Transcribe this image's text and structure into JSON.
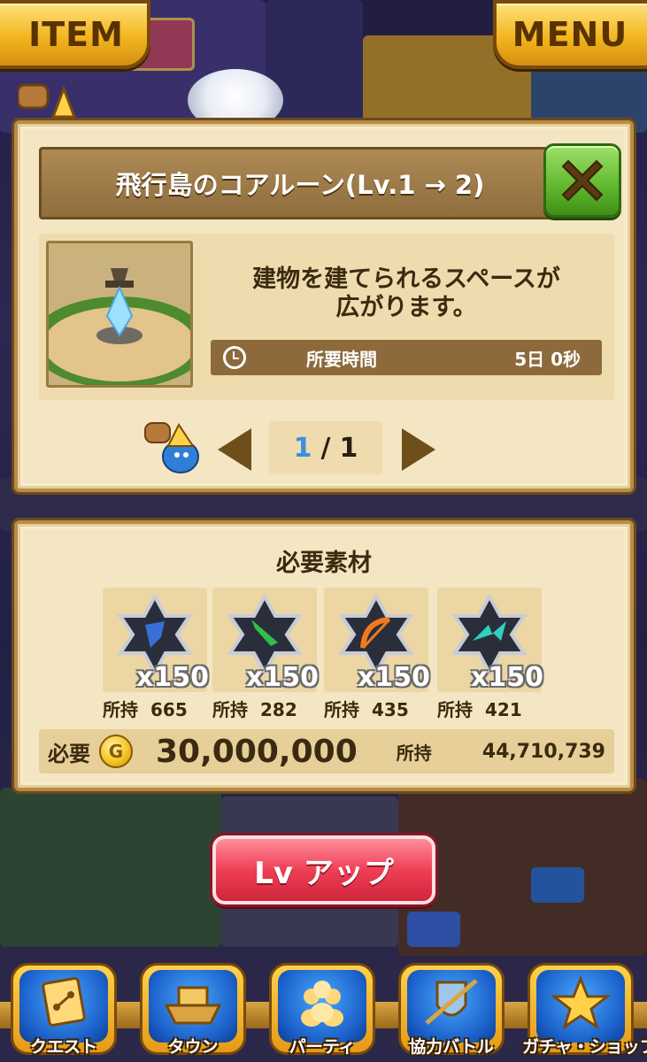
{
  "top_bar": {
    "item_label": "ITEM",
    "menu_label": "MENU"
  },
  "upgrade_panel": {
    "title": "飛行島のコアルーン(Lv.1 → 2)",
    "description_line1": "建物を建てられるスペースが",
    "description_line2": "広がります。",
    "time_label": "所要時間",
    "time_value": "5日 0秒",
    "pager_current": "1",
    "pager_separator": "/",
    "pager_total": "1"
  },
  "materials_panel": {
    "title": "必要素材",
    "owned_label": "所持",
    "items": [
      {
        "icon": "blue-axe-rune-icon",
        "quantity": "x150",
        "owned": "665",
        "color": "#3a6fd8"
      },
      {
        "icon": "green-arrow-rune-icon",
        "quantity": "x150",
        "owned": "282",
        "color": "#2fbf4a"
      },
      {
        "icon": "orange-bow-rune-icon",
        "quantity": "x150",
        "owned": "435",
        "color": "#f07a1a"
      },
      {
        "icon": "teal-wave-rune-icon",
        "quantity": "x150",
        "owned": "421",
        "color": "#2fd0c0"
      }
    ],
    "cost_label": "必要",
    "coin_symbol": "G",
    "cost_value": "30,000,000",
    "owned_gold_label": "所持",
    "owned_gold_value": "44,710,739"
  },
  "level_up_button": "Lv アップ",
  "bottom_nav": [
    {
      "label": "クエスト",
      "icon": "quest-map-icon"
    },
    {
      "label": "タウン",
      "icon": "town-ship-icon"
    },
    {
      "label": "パーティ",
      "icon": "party-people-icon"
    },
    {
      "label": "協力バトル",
      "icon": "coop-battle-shield-icon"
    },
    {
      "label": "ガチャ・ショップ",
      "icon": "gacha-star-icon"
    }
  ],
  "colors": {
    "panel_bg": "#f4e6c2",
    "title_bar": "#8f6d3d",
    "close_button": "#5fb72c",
    "level_up_button": "#ef3f55",
    "top_button": "#f2b51f"
  }
}
